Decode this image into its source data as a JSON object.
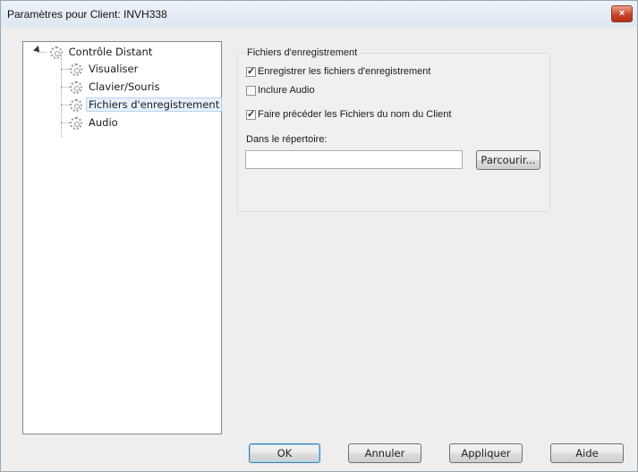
{
  "window": {
    "title": "Paramètres pour Client: INVH338",
    "close_label": "×"
  },
  "tree": {
    "root": "Contrôle Distant",
    "items": [
      {
        "label": "Visualiser"
      },
      {
        "label": "Clavier/Souris"
      },
      {
        "label": "Fichiers d'enregistrement",
        "selected": true
      },
      {
        "label": "Audio"
      }
    ]
  },
  "group": {
    "legend": "Fichiers d'enregistrement",
    "options": [
      {
        "label": "Enregistrer les fichiers d'enregistrement",
        "checked": true
      },
      {
        "label": "Inclure Audio",
        "checked": false
      },
      {
        "label": "Faire précéder les Fichiers du nom du Client",
        "checked": true
      }
    ],
    "directory_label": "Dans le répertoire:",
    "directory_value": "",
    "browse_label": "Parcourir..."
  },
  "buttons": {
    "ok": "OK",
    "cancel": "Annuler",
    "apply": "Appliquer",
    "help": "Aide"
  }
}
